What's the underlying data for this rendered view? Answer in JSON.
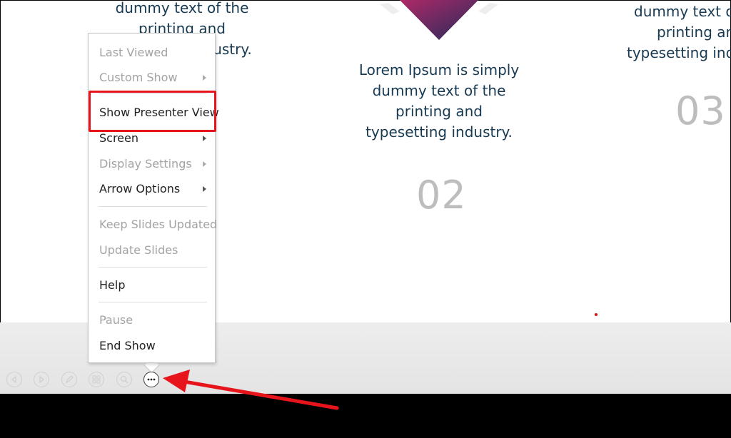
{
  "slide": {
    "col1_text": [
      "dummy text of the",
      "printing and",
      "industry."
    ],
    "col2_text": [
      "Lorem Ipsum is simply",
      "dummy text of the",
      "printing and",
      "typesetting industry."
    ],
    "col2_number": "02",
    "col3_text": [
      "dummy text o",
      "printing an",
      "typesetting ind"
    ],
    "col3_number": "03",
    "colors": {
      "text": "#173a52",
      "number": "#bdbdbd",
      "diamond_top": "#c2296a",
      "diamond_bottom": "#1e2a5a"
    }
  },
  "context_menu": {
    "items": [
      {
        "label": "Last Viewed",
        "enabled": false,
        "submenu": false
      },
      {
        "label": "Custom Show",
        "enabled": false,
        "submenu": true
      },
      {
        "label": "Show Presenter View",
        "enabled": true,
        "submenu": false
      },
      {
        "label": "Screen",
        "enabled": true,
        "submenu": true
      },
      {
        "label": "Display Settings",
        "enabled": false,
        "submenu": true
      },
      {
        "label": "Arrow Options",
        "enabled": true,
        "submenu": true
      },
      {
        "label": "Keep Slides Updated",
        "enabled": false,
        "submenu": false
      },
      {
        "label": "Update Slides",
        "enabled": false,
        "submenu": false
      },
      {
        "label": "Help",
        "enabled": true,
        "submenu": false
      },
      {
        "label": "Pause",
        "enabled": false,
        "submenu": false
      },
      {
        "label": "End Show",
        "enabled": true,
        "submenu": false
      }
    ]
  },
  "toolbar": {
    "buttons": [
      "previous-slide",
      "next-slide",
      "pen-tool",
      "see-all-slides",
      "zoom",
      "more-options"
    ]
  },
  "annotation": {
    "color": "#e8141c"
  }
}
